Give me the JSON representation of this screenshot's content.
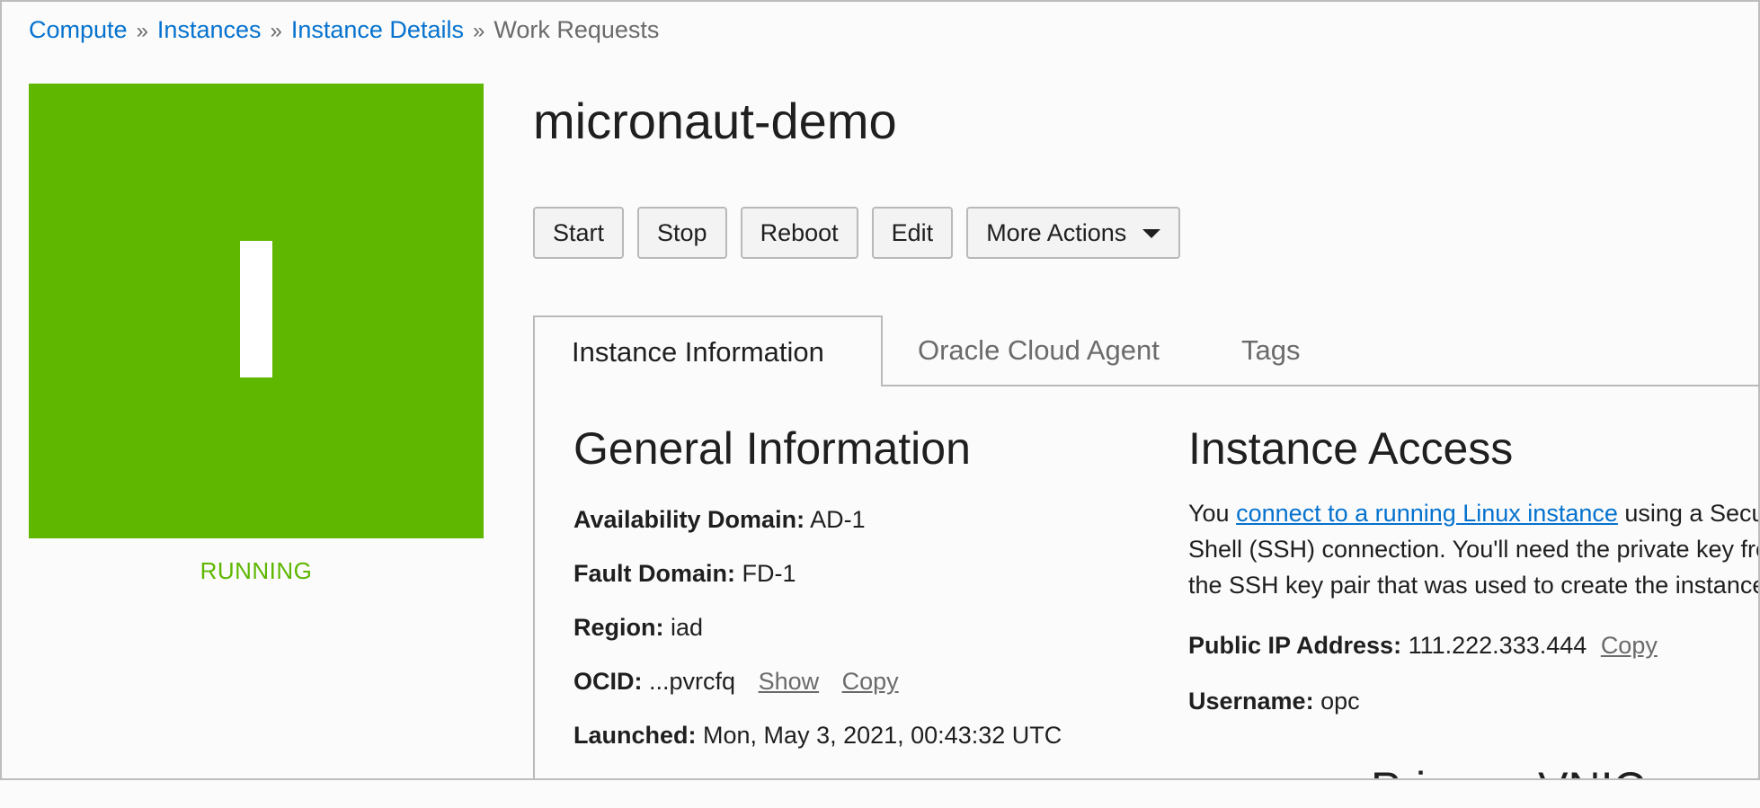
{
  "breadcrumb": {
    "items": [
      "Compute",
      "Instances",
      "Instance Details"
    ],
    "current": "Work Requests",
    "separator": "»"
  },
  "tile": {
    "letter": "I",
    "status": "RUNNING",
    "color": "#5fb700"
  },
  "instance": {
    "name": "micronaut-demo"
  },
  "actions": {
    "start": "Start",
    "stop": "Stop",
    "reboot": "Reboot",
    "edit": "Edit",
    "more": "More Actions"
  },
  "tabs": [
    {
      "label": "Instance Information",
      "active": true
    },
    {
      "label": "Oracle Cloud Agent",
      "active": false
    },
    {
      "label": "Tags",
      "active": false
    }
  ],
  "general": {
    "heading": "General Information",
    "availability_domain": {
      "label": "Availability Domain:",
      "value": "AD-1"
    },
    "fault_domain": {
      "label": "Fault Domain:",
      "value": "FD-1"
    },
    "region": {
      "label": "Region:",
      "value": "iad"
    },
    "ocid": {
      "label": "OCID:",
      "value": "...pvrcfq",
      "show": "Show",
      "copy": "Copy"
    },
    "launched": {
      "label": "Launched:",
      "value": "Mon, May 3, 2021, 00:43:32 UTC"
    }
  },
  "access": {
    "heading": "Instance Access",
    "text_prefix": "You ",
    "link": "connect to a running Linux instance",
    "text_suffix": " using a Secure Shell (SSH) connection. You'll need the private key from the SSH key pair that was used to create the instance.",
    "public_ip": {
      "label": "Public IP Address:",
      "value": "111.222.333.444",
      "copy": "Copy"
    },
    "username": {
      "label": "Username:",
      "value": "opc"
    },
    "next_heading": "Primary VNIC"
  },
  "colors": {
    "link": "#0572ce",
    "accent_green": "#5fb700",
    "border": "#b9b9b9"
  }
}
